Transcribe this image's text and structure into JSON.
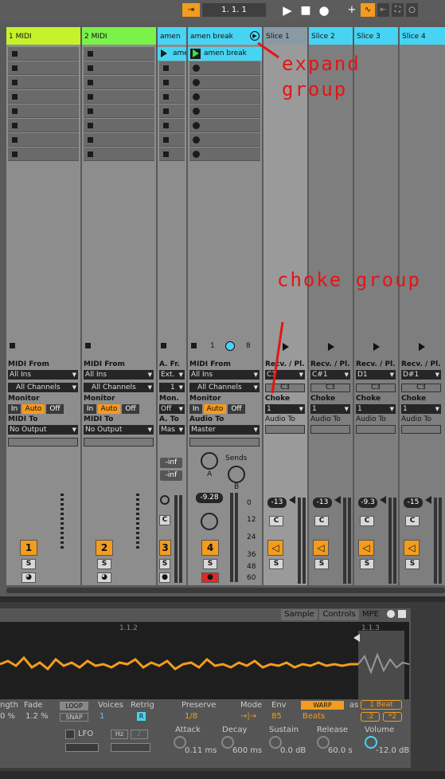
{
  "transport": {
    "position": "1.  1.  1"
  },
  "tracks": [
    {
      "name": "1 MIDI",
      "number": "1",
      "color": "#c6f22c",
      "from_label": "MIDI From",
      "from": "All Ins",
      "channels": "All Channels",
      "monitor_label": "Monitor",
      "mon_in": "In",
      "mon_auto": "Auto",
      "mon_off": "Off",
      "to_label": "MIDI To",
      "to": "No Output",
      "s": "S"
    },
    {
      "name": "2 MIDI",
      "number": "2",
      "color": "#7af24a",
      "from_label": "MIDI From",
      "from": "All Ins",
      "channels": "All Channels",
      "monitor_label": "Monitor",
      "mon_in": "In",
      "mon_auto": "Auto",
      "mon_off": "Off",
      "to_label": "MIDI To",
      "to": "No Output",
      "s": "S"
    }
  ],
  "amen": {
    "name": "amen",
    "clip": "amen",
    "from_label": "A. Fr.",
    "from": "Ext.",
    "channel": "1",
    "monitor_label": "Mon.",
    "monitor": "Off",
    "to_label": "A. To",
    "to": "Mas",
    "send_a": "-inf",
    "send_b": "-inf",
    "c": "C",
    "number": "3",
    "s": "S"
  },
  "amen_break": {
    "name": "amen break",
    "clip": "amen break",
    "chain_from": "1",
    "chain_to": "8",
    "from_label": "MIDI From",
    "from": "All Ins",
    "channels": "All Channels",
    "monitor_label": "Monitor",
    "mon_in": "In",
    "mon_auto": "Auto",
    "mon_off": "Off",
    "to_label": "Audio To",
    "to": "Master",
    "sends": "Sends",
    "send_a_label": "A",
    "send_b_label": "B",
    "volume": "-9.28",
    "c": "C",
    "number": "4",
    "s": "S",
    "scale": [
      "0",
      "12",
      "24",
      "36",
      "48",
      "60"
    ]
  },
  "slices": [
    {
      "name": "Slice 1",
      "recv_label": "Recv. / Pl.",
      "recv": "C1",
      "play": "C3",
      "choke_label": "Choke",
      "choke": "1",
      "to_label": "Audio To",
      "volume": "-13",
      "c": "C",
      "s": "S"
    },
    {
      "name": "Slice 2",
      "recv_label": "Recv. / Pl.",
      "recv": "C#1",
      "play": "C3",
      "choke_label": "Choke",
      "choke": "1",
      "to_label": "Audio To",
      "volume": "-13",
      "c": "C",
      "s": "S"
    },
    {
      "name": "Slice 3",
      "recv_label": "Recv. / Pl.",
      "recv": "D1",
      "play": "C3",
      "choke_label": "Choke",
      "choke": "1",
      "to_label": "Audio To",
      "volume": "-9.3",
      "c": "C",
      "s": "S"
    },
    {
      "name": "Slice 4",
      "recv_label": "Recv. / Pl.",
      "recv": "D#1",
      "play": "C3",
      "choke_label": "Choke",
      "choke": "1",
      "to_label": "Audio To",
      "volume": "-15",
      "c": "C",
      "s": "S"
    }
  ],
  "annotations": {
    "expand": "expand",
    "group": "group",
    "choke": "choke group"
  },
  "device": {
    "tab_sample": "Sample",
    "tab_controls": "Controls",
    "tab_mpe": "MPE",
    "marker1": "1.1.2",
    "marker2": "1.1.3",
    "length_label": "ngth",
    "length": "0 %",
    "fade_label": "Fade",
    "fade": "1.2 %",
    "loop": "LOOP",
    "snap": "SNAP",
    "voices_label": "Voices",
    "voices": "1",
    "retrig_label": "Retrig",
    "retrig": "R",
    "preserve_label": "Preserve",
    "preserve": "1/8",
    "mode_label": "Mode",
    "mode": "→|→",
    "env_label": "Env",
    "env": "85",
    "warp": "WARP",
    "as": "as",
    "beat": "1 Beat",
    "beats": "Beats",
    "div": ":2",
    "mul": "*2",
    "lfo": "LFO",
    "hz": "Hz",
    "attack_label": "Attack",
    "attack": "0.11 ms",
    "decay_label": "Decay",
    "decay": "600 ms",
    "sustain_label": "Sustain",
    "sustain": "0.0 dB",
    "release_label": "Release",
    "release": "60.0 s",
    "volume_label": "Volume",
    "volume": "-12.0 dB"
  }
}
